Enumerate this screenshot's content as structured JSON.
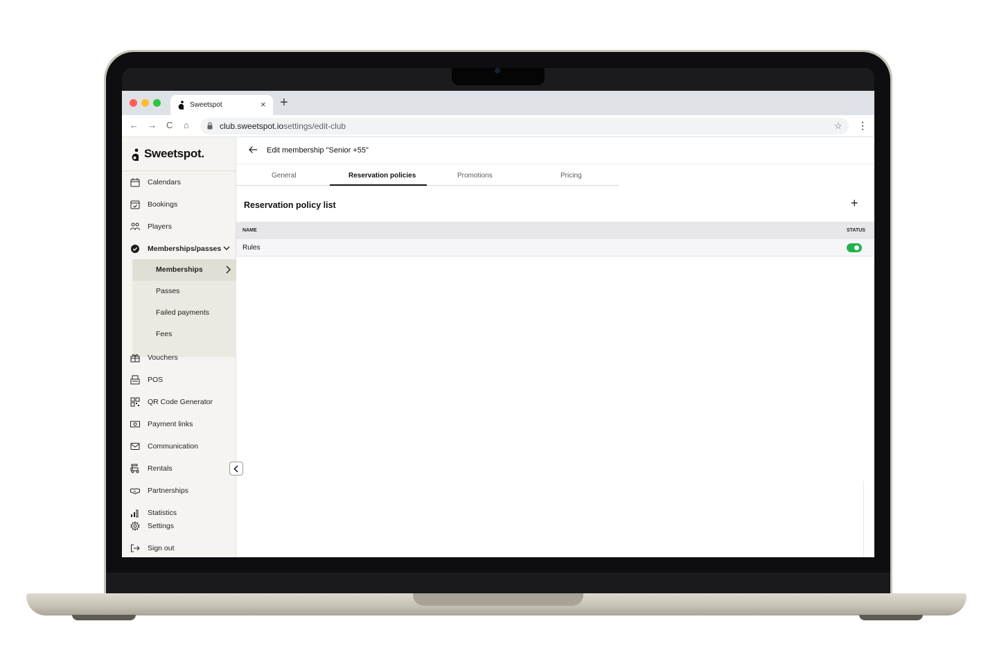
{
  "browser": {
    "tab_title": "Sweetspot",
    "tab_close": "×",
    "new_tab": "+",
    "nav_back": "←",
    "nav_forward": "→",
    "nav_reload": "C",
    "nav_home": "⌂",
    "url_domain": "club.sweetspot.io",
    "url_path": "settings/edit-club",
    "bookmark": "☆",
    "menu": "⋮"
  },
  "sidebar": {
    "logo": "Sweetspot.",
    "items": [
      {
        "label": "Calendars",
        "icon": "calendar-icon"
      },
      {
        "label": "Bookings",
        "icon": "booking-icon"
      },
      {
        "label": "Players",
        "icon": "players-icon"
      },
      {
        "label": "Memberships/passes",
        "icon": "membership-badge-icon"
      },
      {
        "label": "Vouchers",
        "icon": "gift-icon"
      },
      {
        "label": "POS",
        "icon": "register-icon"
      },
      {
        "label": "QR Code Generator",
        "icon": "qr-code-icon"
      },
      {
        "label": "Payment links",
        "icon": "money-icon"
      },
      {
        "label": "Communication",
        "icon": "mail-icon"
      },
      {
        "label": "Rentals",
        "icon": "golf-cart-icon"
      },
      {
        "label": "Partnerships",
        "icon": "handshake-icon"
      },
      {
        "label": "Statistics",
        "icon": "bar-chart-icon"
      },
      {
        "label": "Settings",
        "icon": "gear-icon"
      },
      {
        "label": "Sign out",
        "icon": "sign-out-icon"
      }
    ],
    "subitems": [
      {
        "label": "Memberships"
      },
      {
        "label": "Passes"
      },
      {
        "label": "Failed payments"
      },
      {
        "label": "Fees"
      }
    ]
  },
  "main": {
    "title": "Edit membership \"Senior +55\"",
    "tabs": [
      {
        "label": "General"
      },
      {
        "label": "Reservation policies"
      },
      {
        "label": "Promotions"
      },
      {
        "label": "Pricing"
      }
    ],
    "active_tab": "Reservation policies",
    "section_title": "Reservation policy list",
    "add_label": "+",
    "table": {
      "headers": [
        "NAME",
        "STATUS"
      ],
      "rows": [
        {
          "name": "Rules",
          "status": "on"
        }
      ]
    }
  },
  "colors": {
    "toggle_on": "#22b14c",
    "sidebar_bg": "#f5f4f0"
  }
}
